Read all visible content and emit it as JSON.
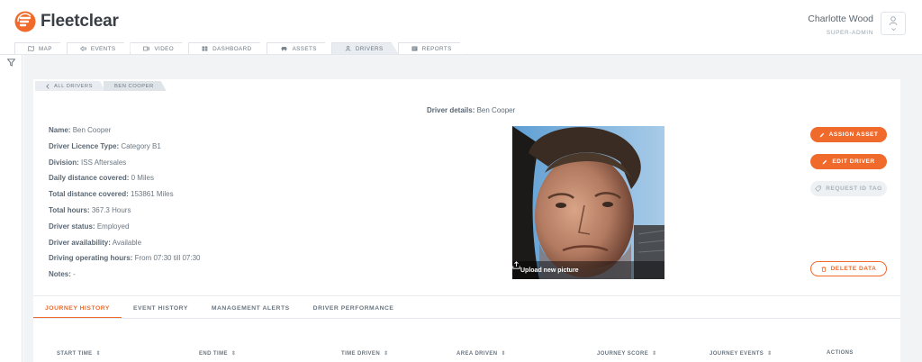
{
  "app": {
    "brand": "Fleetclear",
    "brand_color": "#ef6a2b"
  },
  "user": {
    "name": "Charlotte Wood",
    "role": "SUPER-ADMIN"
  },
  "nav": {
    "tabs": [
      {
        "label": "MAP",
        "icon": "map-icon"
      },
      {
        "label": "EVENTS",
        "icon": "events-icon"
      },
      {
        "label": "VIDEO",
        "icon": "video-icon"
      },
      {
        "label": "DASHBOARD",
        "icon": "dashboard-icon"
      },
      {
        "label": "ASSETS",
        "icon": "car-icon"
      },
      {
        "label": "DRIVERS",
        "icon": "user-icon",
        "active": true
      },
      {
        "label": "REPORTS",
        "icon": "reports-icon"
      }
    ]
  },
  "breadcrumb": {
    "back_label": "ALL DRIVERS",
    "current": "BEN COOPER"
  },
  "driver": {
    "title_key": "Driver details:",
    "title_value": "Ben Cooper",
    "fields": [
      {
        "key": "Name:",
        "value": "Ben Cooper"
      },
      {
        "key": "Driver Licence Type:",
        "value": "Category B1"
      },
      {
        "key": "Division:",
        "value": "ISS Aftersales"
      },
      {
        "key": "Daily distance covered:",
        "value": "0 Miles"
      },
      {
        "key": "Total distance covered:",
        "value": "153861 Miles"
      },
      {
        "key": "Total hours:",
        "value": "367.3 Hours"
      },
      {
        "key": "Driver status:",
        "value": "Employed"
      },
      {
        "key": "Driver availability:",
        "value": "Available"
      },
      {
        "key": "Driving operating hours:",
        "value": "From 07:30 till 07:30"
      },
      {
        "key": "Notes:",
        "value": "-"
      }
    ],
    "upload_label": "Upload new picture"
  },
  "actions": {
    "assign_asset": "ASSIGN ASSET",
    "edit_driver": "EDIT DRIVER",
    "request_id_tag": "REQUEST ID TAG",
    "delete_data": "DELETE DATA"
  },
  "tabs": [
    {
      "label": "JOURNEY HISTORY",
      "active": true
    },
    {
      "label": "EVENT HISTORY"
    },
    {
      "label": "MANAGEMENT ALERTS"
    },
    {
      "label": "DRIVER PERFORMANCE"
    }
  ],
  "table": {
    "columns": [
      "START TIME",
      "END TIME",
      "TIME DRIVEN",
      "AREA DRIVEN",
      "JOURNEY SCORE",
      "JOURNEY EVENTS",
      "ACTIONS"
    ]
  }
}
